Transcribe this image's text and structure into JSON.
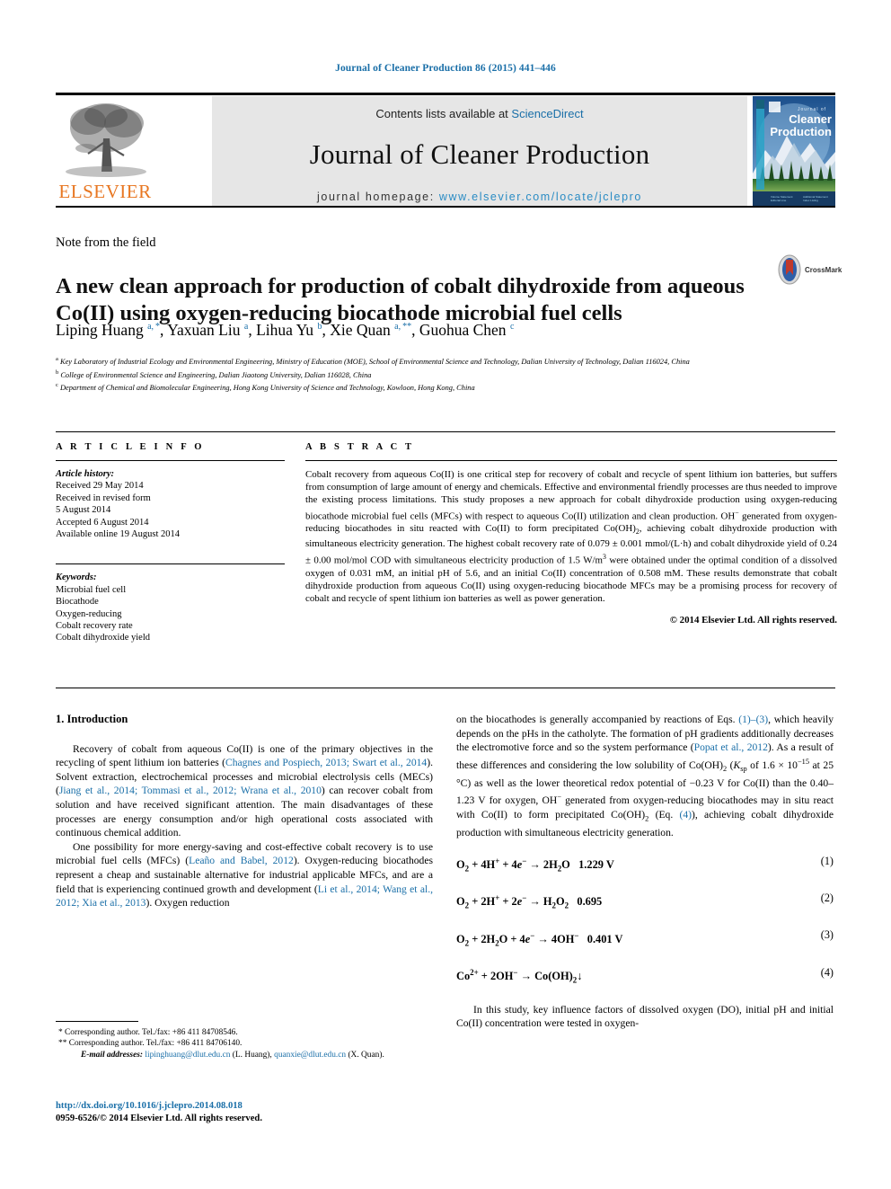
{
  "running_head": "Journal of Cleaner Production 86 (2015) 441–446",
  "masthead": {
    "contents_prefix": "Contents lists available at ",
    "contents_link": "ScienceDirect",
    "journal_title": "Journal of Cleaner Production",
    "homepage_prefix": "journal homepage: ",
    "homepage_url": "www.elsevier.com/locate/jclepro",
    "publisher": "ELSEVIER",
    "cover_line1": "Journal of",
    "cover_line2": "Cleaner",
    "cover_line3": "Production"
  },
  "article": {
    "type": "Note from the field",
    "title": "A new clean approach for production of cobalt dihydroxide from aqueous Co(II) using oxygen-reducing biocathode microbial fuel cells",
    "crossmark_label": "CrossMark",
    "authors_html": "Liping Huang <sup>a, *</sup>, Yaxuan Liu <sup>a</sup>, Lihua Yu <sup>b</sup>, Xie Quan <sup>a, **</sup>, Guohua Chen <sup>c</sup>",
    "affiliations": [
      "Key Laboratory of Industrial Ecology and Environmental Engineering, Ministry of Education (MOE), School of Environmental Science and Technology, Dalian University of Technology, Dalian 116024, China",
      "College of Environmental Science and Engineering, Dalian Jiaotong University, Dalian 116028, China",
      "Department of Chemical and Biomolecular Engineering, Hong Kong University of Science and Technology, Kowloon, Hong Kong, China"
    ],
    "affiliation_marks": [
      "a",
      "b",
      "c"
    ]
  },
  "article_info": {
    "heading": "A R T I C L E   I N F O",
    "history_label": "Article history:",
    "history": [
      "Received 29 May 2014",
      "Received in revised form",
      "5 August 2014",
      "Accepted 6 August 2014",
      "Available online 19 August 2014"
    ],
    "keywords_label": "Keywords:",
    "keywords": [
      "Microbial fuel cell",
      "Biocathode",
      "Oxygen-reducing",
      "Cobalt recovery rate",
      "Cobalt dihydroxide yield"
    ]
  },
  "abstract": {
    "heading": "A B S T R A C T",
    "body_html": "Cobalt recovery from aqueous Co(II) is one critical step for recovery of cobalt and recycle of spent lithium ion batteries, but suffers from consumption of large amount of energy and chemicals. Effective and environmental friendly processes are thus needed to improve the existing process limitations. This study proposes a new approach for cobalt dihydroxide production using oxygen-reducing biocathode microbial fuel cells (MFCs) with respect to aqueous Co(II) utilization and clean production. OH<sup>−</sup> generated from oxygen-reducing biocathodes in situ reacted with Co(II) to form precipitated Co(OH)<sub>2</sub>, achieving cobalt dihydroxide production with simultaneous electricity generation. The highest cobalt recovery rate of 0.079 ± 0.001 mmol/(L·h) and cobalt dihydroxide yield of 0.24 ± 0.00 mol/mol COD with simultaneous electricity production of 1.5 W/m<sup>3</sup> were obtained under the optimal condition of a dissolved oxygen of 0.031 mM, an initial pH of 5.6, and an initial Co(II) concentration of 0.508 mM. These results demonstrate that cobalt dihydroxide production from aqueous Co(II) using oxygen-reducing biocathode MFCs may be a promising process for recovery of cobalt and recycle of spent lithium ion batteries as well as power generation.",
    "copyright": "© 2014 Elsevier Ltd. All rights reserved."
  },
  "body": {
    "section_heading": "1. Introduction",
    "left_p1_html": "Recovery of cobalt from aqueous Co(II) is one of the primary objectives in the recycling of spent lithium ion batteries (<span class=\"cite\">Chagnes and Pospiech, 2013; Swart et al., 2014</span>). Solvent extraction, electrochemical processes and microbial electrolysis cells (MECs) (<span class=\"cite\">Jiang et al., 2014; Tommasi et al., 2012; Wrana et al., 2010</span>) can recover cobalt from solution and have received significant attention. The main disadvantages of these processes are energy consumption and/or high operational costs associated with continuous chemical addition.",
    "left_p2_html": "One possibility for more energy-saving and cost-effective cobalt recovery is to use microbial fuel cells (MFCs) (<span class=\"cite\">Leaño and Babel, 2012</span>). Oxygen-reducing biocathodes represent a cheap and sustainable alternative for industrial applicable MFCs, and are a field that is experiencing continued growth and development (<span class=\"cite\">Li et al., 2014; Wang et al., 2012; Xia et al., 2013</span>). Oxygen reduction",
    "right_p1_html": "on the biocathodes is generally accompanied by reactions of Eqs. <span class=\"cite\">(1)–(3)</span>, which heavily depends on the pHs in the catholyte. The formation of pH gradients additionally decreases the electromotive force and so the system performance (<span class=\"cite\">Popat et al., 2012</span>). As a result of these differences and considering the low solubility of Co(OH)<sub>2</sub> (<i>K</i><sub>sp</sub> of 1.6 × 10<sup>−15</sup> at 25 °C) as well as the lower theoretical redox potential of −0.23 V for Co(II) than the 0.40–1.23 V for oxygen, OH<sup>−</sup> generated from oxygen-reducing biocathodes may in situ react with Co(II) to form precipitated Co(OH)<sub>2</sub> (Eq. <span class=\"cite\">(4)</span>), achieving cobalt dihydroxide production with simultaneous electricity generation.",
    "right_p2_html": "In this study, key influence factors of dissolved oxygen (DO), initial pH and initial Co(II) concentration were tested in oxygen-",
    "equations": [
      {
        "html": "O<sub>2</sub> + 4H<sup>+</sup> + 4<i>e</i><sup>−</sup> → 2H<sub>2</sub>O&nbsp;&nbsp;&nbsp;1.229 V",
        "number": "(1)"
      },
      {
        "html": "O<sub>2</sub> + 2H<sup>+</sup> + 2<i>e</i><sup>−</sup> → H<sub>2</sub>O<sub>2</sub>&nbsp;&nbsp;&nbsp;0.695",
        "number": "(2)"
      },
      {
        "html": "O<sub>2</sub> + 2H<sub>2</sub>O + 4<i>e</i><sup>−</sup> → 4OH<sup>−</sup>&nbsp;&nbsp;&nbsp;0.401 V",
        "number": "(3)"
      },
      {
        "html": "Co<sup>2+</sup> + 2OH<sup>−</sup> → Co(OH)<sub>2</sub>↓",
        "number": "(4)"
      }
    ]
  },
  "footnotes": {
    "line1": "* Corresponding author. Tel./fax: +86 411 84708546.",
    "line2": "** Corresponding author. Tel./fax: +86 411 84706140.",
    "email_label": "E-mail addresses:",
    "email1": "lipinghuang@dlut.edu.cn",
    "email1_owner": "(L. Huang),",
    "email2": "quanxie@dlut.edu.cn",
    "email2_owner": "(X. Quan)."
  },
  "doi_block": {
    "doi": "http://dx.doi.org/10.1016/j.jclepro.2014.08.018",
    "issn_line": "0959-6526/© 2014 Elsevier Ltd. All rights reserved."
  },
  "colors": {
    "link_blue": "#1a6fa8",
    "elsevier_orange": "#e87722",
    "band_gray": "#e6e6e6"
  }
}
